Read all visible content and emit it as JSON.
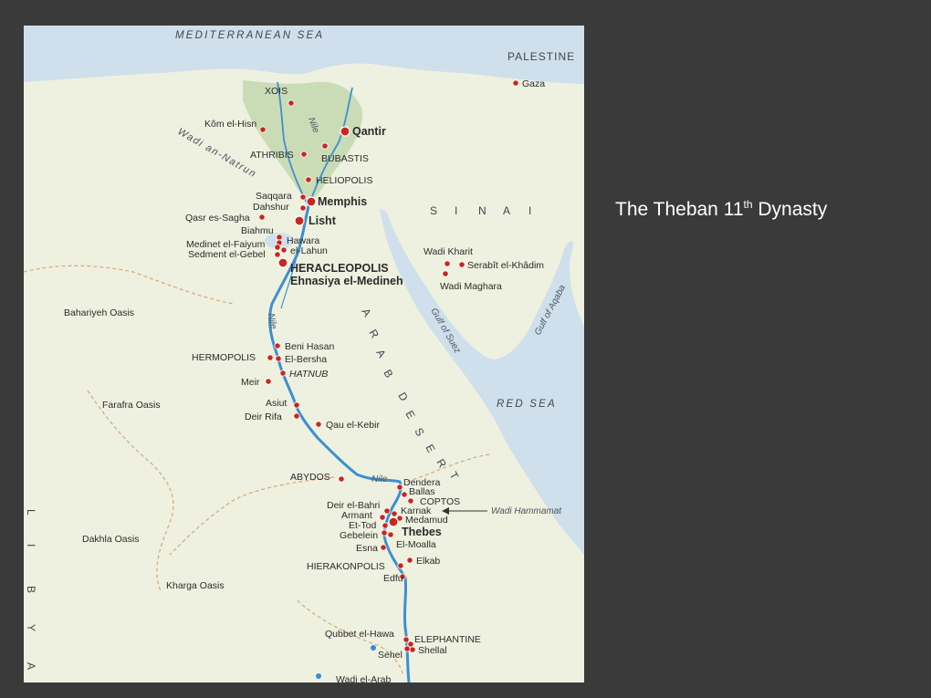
{
  "caption": {
    "prefix": "The Theban 11",
    "sup": "th",
    "suffix": " Dynasty"
  },
  "seas": {
    "mediterranean": "MEDITERRANEAN SEA",
    "red_sea": "RED SEA"
  },
  "regions": {
    "palestine": "PALESTINE",
    "sinai": [
      "S",
      "I",
      "N",
      "A",
      "I"
    ],
    "arab_desert": [
      "A",
      "R",
      "A",
      "B",
      "D",
      "E",
      "S",
      "E",
      "R",
      "T"
    ],
    "libya": [
      "L",
      "I",
      "B",
      "Y",
      "A"
    ]
  },
  "water_labels": {
    "nile_north": "Nile",
    "nile_mid": "Nile",
    "nile_south": "Nile",
    "wadi_natrun": "Wadi an-Natrun",
    "gulf_suez": "Gulf of Suez",
    "gulf_aqaba": "Gulf of Aqaba",
    "wadi_hammamat": "Wadi Hammamat"
  },
  "oases": {
    "bahariyeh": "Bahariyeh Oasis",
    "farafra": "Farafra Oasis",
    "dakhla": "Dakhla Oasis",
    "kharga": "Kharga Oasis"
  },
  "places": {
    "gaza": "Gaza",
    "xois": "XOIS",
    "kom_el_hisn": "Kôm el-Hisn",
    "qantir": "Qantir",
    "athribis": "ATHRIBIS",
    "bubastis": "BUBASTIS",
    "heliopolis": "HELIOPOLIS",
    "saqqara": "Saqqara",
    "dahshur": "Dahshur",
    "memphis": "Memphis",
    "qasr_es_sagha": "Qasr es-Sagha",
    "lisht": "Lisht",
    "biahmu": "Biahmu",
    "hawara": "Hawara",
    "medinet_el_faiyum": "Medinet el-Faiyum",
    "el_lahun": "el-Lahun",
    "sedment_el_gebel": "Sedment el-Gebel",
    "heracleopolis": "HERACLEOPOLIS",
    "ehnasiya": "Ehnasiya el-Medineh",
    "wadi_kharit": "Wadi Kharit",
    "serabit": "Serabît el-Khâdim",
    "wadi_maghara": "Wadi Maghara",
    "beni_hasan": "Beni Hasan",
    "hermopolis": "HERMOPOLIS",
    "el_bersha": "El-Bersha",
    "hatnub": "HATNUB",
    "meir": "Meir",
    "asiut": "Asiut",
    "deir_rifa": "Deir Rifa",
    "qau_el_kebir": "Qau el-Kebir",
    "abydos": "ABYDOS",
    "dendera": "Dendera",
    "ballas": "Ballas",
    "coptos": "COPTOS",
    "deir_el_bahri": "Deir el-Bahri",
    "armant": "Armant",
    "karnak": "Karnak",
    "medamud": "Medamud",
    "et_tod": "Et-Tod",
    "thebes": "Thebes",
    "gebelein": "Gebelein",
    "el_moalla": "El-Moalla",
    "esna": "Esna",
    "elkab": "Elkab",
    "hierakonpolis": "HIERAKONPOLIS",
    "edfu": "Edfu",
    "qubbet_el_hawa": "Qubbet el-Hawa",
    "elephantine": "ELEPHANTINE",
    "sehel": "Sehel",
    "shellal": "Shellal",
    "wadi_el_arab": "Wadi el-Arab"
  },
  "colors": {
    "slide_bg": "#3a3a3a",
    "land": "#eef1df",
    "sea": "#cfe0ec",
    "river": "#3d8fd1",
    "delta_green": "#c9dcb6",
    "site_dot": "#c8271f",
    "caption_text": "#ffffff"
  }
}
